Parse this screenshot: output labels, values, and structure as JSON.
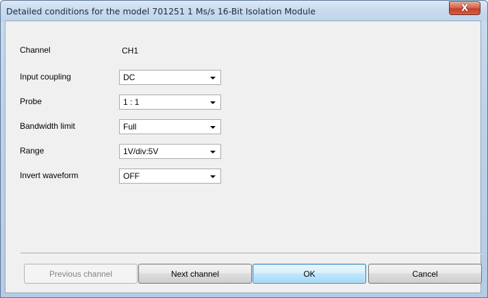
{
  "window": {
    "title": "Detailed conditions for the model 701251 1 Ms/s 16-Bit Isolation Module",
    "close_glyph": "X"
  },
  "form": {
    "channel": {
      "label": "Channel",
      "value": "CH1"
    },
    "input_coupling": {
      "label": "Input coupling",
      "value": "DC"
    },
    "probe": {
      "label": "Probe",
      "value": "1 : 1"
    },
    "bandwidth_limit": {
      "label": "Bandwidth limit",
      "value": "Full"
    },
    "range": {
      "label": "Range",
      "value": "1V/div:5V"
    },
    "invert_waveform": {
      "label": "Invert waveform",
      "value": "OFF"
    }
  },
  "buttons": {
    "previous_channel": "Previous channel",
    "next_channel": "Next channel",
    "ok": "OK",
    "cancel": "Cancel"
  },
  "colors": {
    "accent_default_button": "#3c7fb1",
    "close_button": "#c6402a",
    "dialog_background": "#f0f0f0"
  },
  "icons": {
    "close": "close-icon",
    "dropdown": "chevron-down-icon"
  }
}
